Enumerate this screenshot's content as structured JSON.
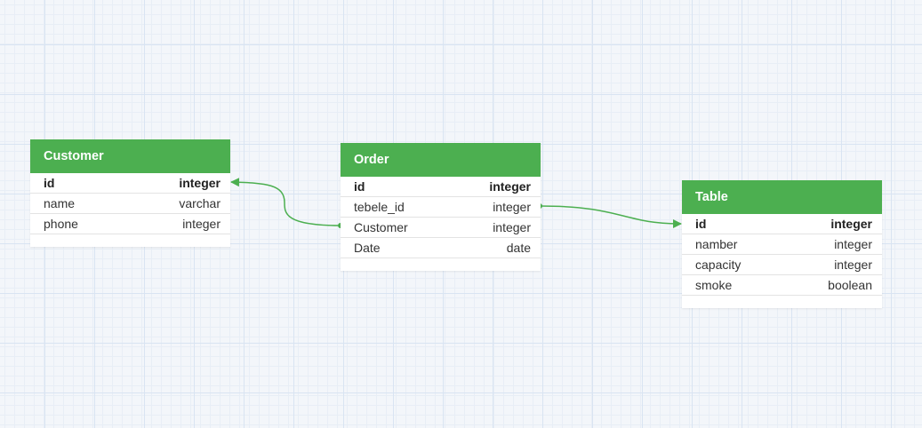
{
  "colors": {
    "header": "#4caf50",
    "connector": "#4caf50"
  },
  "entities": {
    "customer": {
      "title": "Customer",
      "attributes": [
        {
          "name": "id",
          "type": "integer",
          "primary": true
        },
        {
          "name": "name",
          "type": "varchar",
          "primary": false
        },
        {
          "name": "phone",
          "type": "integer",
          "primary": false
        }
      ]
    },
    "order": {
      "title": "Order",
      "attributes": [
        {
          "name": "id",
          "type": "integer",
          "primary": true
        },
        {
          "name": "tebele_id",
          "type": "integer",
          "primary": false
        },
        {
          "name": "Customer",
          "type": "integer",
          "primary": false
        },
        {
          "name": "Date",
          "type": "date",
          "primary": false
        }
      ]
    },
    "table": {
      "title": "Table",
      "attributes": [
        {
          "name": "id",
          "type": "integer",
          "primary": true
        },
        {
          "name": "namber",
          "type": "integer",
          "primary": false
        },
        {
          "name": "capacity",
          "type": "integer",
          "primary": false
        },
        {
          "name": "smoke",
          "type": "boolean",
          "primary": false
        }
      ]
    }
  },
  "relations": [
    {
      "from": "order.Customer",
      "to": "customer.id"
    },
    {
      "from": "order.tebele_id",
      "to": "table.id"
    }
  ]
}
